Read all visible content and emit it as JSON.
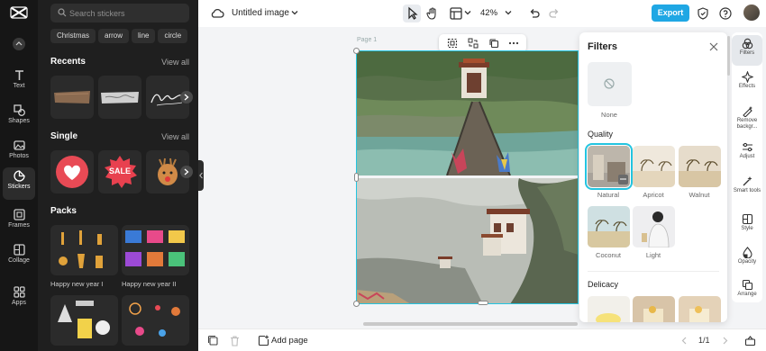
{
  "rail": {
    "items": [
      {
        "label": "Text",
        "icon": "text-icon"
      },
      {
        "label": "Shapes",
        "icon": "shapes-icon"
      },
      {
        "label": "Photos",
        "icon": "photos-icon"
      },
      {
        "label": "Stickers",
        "icon": "stickers-icon"
      },
      {
        "label": "Frames",
        "icon": "frames-icon"
      },
      {
        "label": "Collage",
        "icon": "collage-icon"
      },
      {
        "label": "Apps",
        "icon": "apps-icon"
      }
    ]
  },
  "stickers": {
    "search_placeholder": "Search stickers",
    "chips": [
      "Christmas",
      "arrow",
      "line",
      "circle"
    ],
    "recents_title": "Recents",
    "recents_view_all": "View all",
    "single_title": "Single",
    "single_view_all": "View all",
    "single_sale_text": "SALE",
    "packs_title": "Packs",
    "packs": [
      {
        "label": "Happy new year I"
      },
      {
        "label": "Happy new year II"
      },
      {
        "label": ""
      },
      {
        "label": ""
      }
    ]
  },
  "topbar": {
    "title": "Untitled image",
    "zoom": "42%",
    "export_label": "Export"
  },
  "canvas": {
    "page_label": "Page 1"
  },
  "filters": {
    "title": "Filters",
    "none_label": "None",
    "quality_title": "Quality",
    "quality_items": [
      "Natural",
      "Apricot",
      "Walnut",
      "Coconut",
      "Light"
    ],
    "delicacy_title": "Delicacy",
    "selected": "Natural"
  },
  "right_tools": [
    {
      "label": "Filters",
      "icon": "filters-icon"
    },
    {
      "label": "Effects",
      "icon": "effects-icon"
    },
    {
      "label": "Remove backgr...",
      "icon": "remove-background-icon"
    },
    {
      "label": "Adjust",
      "icon": "adjust-icon"
    },
    {
      "label": "Smart tools",
      "icon": "smart-tools-icon"
    },
    {
      "label": "Style",
      "icon": "style-icon"
    },
    {
      "label": "Opacity",
      "icon": "opacity-icon"
    },
    {
      "label": "Arrange",
      "icon": "arrange-icon"
    }
  ],
  "bottombar": {
    "add_page_label": "Add page",
    "page_count": "1/1"
  },
  "colors": {
    "accent": "#1fa7e4",
    "selection": "#23c4e0",
    "sidebar_bg": "#161616",
    "panel_bg": "#1f1f1f"
  }
}
